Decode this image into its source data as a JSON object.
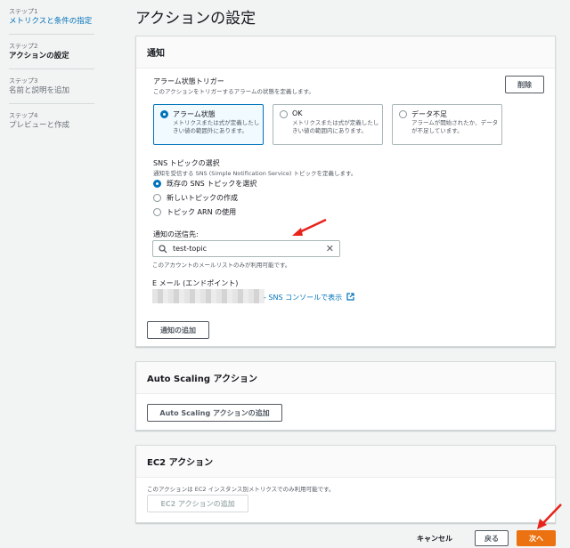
{
  "steps": [
    {
      "label": "ステップ1",
      "title": "メトリクスと条件の指定"
    },
    {
      "label": "ステップ2",
      "title": "アクションの設定"
    },
    {
      "label": "ステップ3",
      "title": "名前と説明を追加"
    },
    {
      "label": "ステップ4",
      "title": "プレビューと作成"
    }
  ],
  "page_title": "アクションの設定",
  "notification": {
    "header": "通知",
    "trigger_label": "アラーム状態トリガー",
    "trigger_desc": "このアクションをトリガーするアラームの状態を定義します。",
    "delete_button": "削除",
    "tiles": [
      {
        "title": "アラーム状態",
        "desc": "メトリクスまたは式が定義したしきい値の範囲外にあります。"
      },
      {
        "title": "OK",
        "desc": "メトリクスまたは式が定義したしきい値の範囲内にあります。"
      },
      {
        "title": "データ不足",
        "desc": "アラームが開始されたか、データが不足しています。"
      }
    ],
    "sns_label": "SNS トピックの選択",
    "sns_desc": "通知を受信する SNS (Simple Notification Service) トピックを定義します。",
    "sns_options": [
      "既存の SNS トピックを選択",
      "新しいトピックの作成",
      "トピック ARN の使用"
    ],
    "send_to_label": "通知の送信先:",
    "search_value": "test-topic",
    "search_hint": "このアカウントのメールリストのみが利用可能です。",
    "email_label": "E メール (エンドポイント)",
    "sns_console_link": "- SNS コンソールで表示",
    "add_notification": "通知の追加"
  },
  "autoscaling": {
    "header": "Auto Scaling アクション",
    "add_button": "Auto Scaling アクションの追加"
  },
  "ec2": {
    "header": "EC2 アクション",
    "desc": "このアクションは EC2 インスタンス別メトリクスでのみ利用可能です。",
    "add_button": "EC2 アクションの追加"
  },
  "footer": {
    "cancel": "キャンセル",
    "back": "戻る",
    "next": "次へ"
  },
  "colors": {
    "accent": "#0073bb",
    "primary_button": "#ec7211",
    "annotation_arrow": "#e8231b"
  }
}
